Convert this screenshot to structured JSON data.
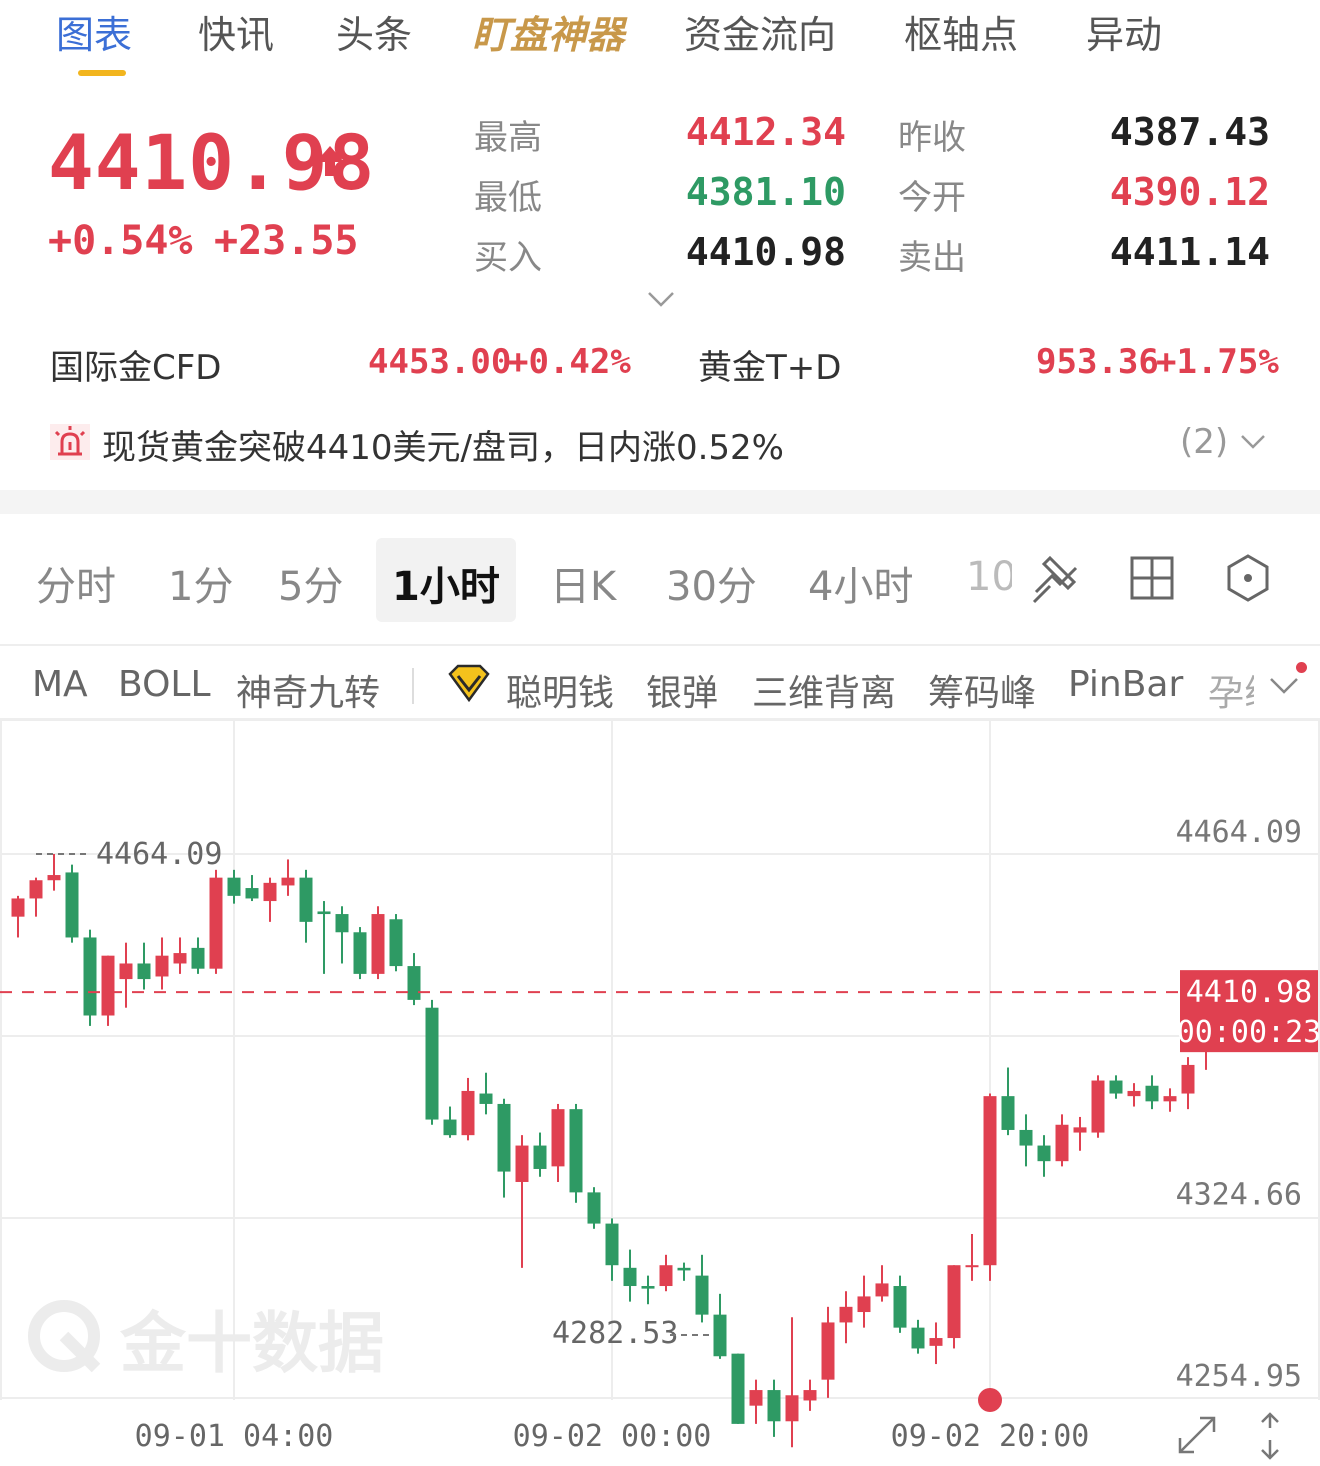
{
  "tabs": [
    {
      "label": "图表",
      "active": true
    },
    {
      "label": "快讯"
    },
    {
      "label": "头条"
    },
    {
      "label": "盯盘神器"
    },
    {
      "label": "资金流向"
    },
    {
      "label": "枢轴点"
    },
    {
      "label": "异动"
    }
  ],
  "quote": {
    "price": "4410.98",
    "change_pct": "+0.54%",
    "change_abs": "+23.55",
    "high_label": "最高",
    "high": "4412.34",
    "low_label": "最低",
    "low": "4381.10",
    "bid_label": "买入",
    "bid": "4410.98",
    "prev_close_label": "昨收",
    "prev_close": "4387.43",
    "open_label": "今开",
    "open": "4390.12",
    "ask_label": "卖出",
    "ask": "4411.14"
  },
  "related": [
    {
      "name": "国际金CFD",
      "price": "4453.00",
      "pct": "+0.42%"
    },
    {
      "name": "黄金T+D",
      "price": "953.36",
      "pct": "+1.75%"
    }
  ],
  "news": {
    "text": "现货黄金突破4410美元/盘司，日内涨0.52%",
    "count": "(2)"
  },
  "periods": [
    {
      "label": "分时"
    },
    {
      "label": "1分"
    },
    {
      "label": "5分"
    },
    {
      "label": "1小时",
      "active": true
    },
    {
      "label": "日K"
    },
    {
      "label": "30分"
    },
    {
      "label": "4小时"
    },
    {
      "label": "10"
    }
  ],
  "indicators": [
    "MA",
    "BOLL",
    "神奇九转",
    "聪明钱",
    "银弹",
    "三维背离",
    "筹码峰",
    "PinBar",
    "孕线"
  ],
  "colors": {
    "up": "#e04050",
    "down": "#2e9a64",
    "accent": "#3b6fd6",
    "tab_underline": "#f2b51e"
  },
  "chart_data": {
    "type": "candlestick",
    "ylim": [
      4254.95,
      4486.79
    ],
    "y_ticks": [
      4464.09,
      4324.66,
      4254.95
    ],
    "x_ticks": [
      {
        "index": 12,
        "label": "09-01 04:00"
      },
      {
        "index": 33,
        "label": "09-02 00:00"
      },
      {
        "index": 54,
        "label": "09-02 20:00"
      }
    ],
    "max_label": "4464.09",
    "min_label": "4282.53",
    "current_price": "4410.98",
    "countdown": "00:00:23",
    "watermark": "金十数据",
    "candles": [
      {
        "o": 4440,
        "h": 4448,
        "l": 4432,
        "c": 4447
      },
      {
        "o": 4447,
        "h": 4455,
        "l": 4440,
        "c": 4454
      },
      {
        "o": 4454,
        "h": 4464.09,
        "l": 4450,
        "c": 4456
      },
      {
        "o": 4457,
        "h": 4460,
        "l": 4430,
        "c": 4432
      },
      {
        "o": 4432,
        "h": 4435,
        "l": 4398,
        "c": 4402
      },
      {
        "o": 4402,
        "h": 4424,
        "l": 4398,
        "c": 4425
      },
      {
        "o": 4416,
        "h": 4430,
        "l": 4405,
        "c": 4422
      },
      {
        "o": 4422,
        "h": 4430,
        "l": 4412,
        "c": 4416
      },
      {
        "o": 4417,
        "h": 4432,
        "l": 4412,
        "c": 4425
      },
      {
        "o": 4422,
        "h": 4432,
        "l": 4418,
        "c": 4426
      },
      {
        "o": 4428,
        "h": 4432,
        "l": 4418,
        "c": 4420
      },
      {
        "o": 4420,
        "h": 4458,
        "l": 4418,
        "c": 4455
      },
      {
        "o": 4455,
        "h": 4458,
        "l": 4445,
        "c": 4448
      },
      {
        "o": 4451,
        "h": 4456,
        "l": 4446,
        "c": 4447
      },
      {
        "o": 4446,
        "h": 4455,
        "l": 4438,
        "c": 4453
      },
      {
        "o": 4452,
        "h": 4462,
        "l": 4448,
        "c": 4455
      },
      {
        "o": 4455,
        "h": 4458,
        "l": 4430,
        "c": 4438
      },
      {
        "o": 4442,
        "h": 4446,
        "l": 4418,
        "c": 4441
      },
      {
        "o": 4441,
        "h": 4444,
        "l": 4422,
        "c": 4434
      },
      {
        "o": 4434,
        "h": 4436,
        "l": 4416,
        "c": 4418
      },
      {
        "o": 4418,
        "h": 4444,
        "l": 4416,
        "c": 4441
      },
      {
        "o": 4439,
        "h": 4441,
        "l": 4419,
        "c": 4421
      },
      {
        "o": 4421,
        "h": 4426,
        "l": 4406,
        "c": 4408
      },
      {
        "o": 4405,
        "h": 4408,
        "l": 4360,
        "c": 4362
      },
      {
        "o": 4362,
        "h": 4367,
        "l": 4355,
        "c": 4356
      },
      {
        "o": 4356,
        "h": 4378,
        "l": 4354,
        "c": 4373
      },
      {
        "o": 4372,
        "h": 4380,
        "l": 4364,
        "c": 4368
      },
      {
        "o": 4368,
        "h": 4370,
        "l": 4332,
        "c": 4342
      },
      {
        "o": 4338,
        "h": 4356,
        "l": 4305,
        "c": 4352
      },
      {
        "o": 4352,
        "h": 4357,
        "l": 4340,
        "c": 4343
      },
      {
        "o": 4344,
        "h": 4368,
        "l": 4338,
        "c": 4366
      },
      {
        "o": 4366,
        "h": 4368,
        "l": 4330,
        "c": 4334
      },
      {
        "o": 4334,
        "h": 4336,
        "l": 4320,
        "c": 4322
      },
      {
        "o": 4322,
        "h": 4324,
        "l": 4300,
        "c": 4306
      },
      {
        "o": 4305,
        "h": 4312,
        "l": 4292,
        "c": 4298
      },
      {
        "o": 4298,
        "h": 4302,
        "l": 4291,
        "c": 4297
      },
      {
        "o": 4298,
        "h": 4310,
        "l": 4296,
        "c": 4306
      },
      {
        "o": 4305,
        "h": 4307,
        "l": 4300,
        "c": 4304
      },
      {
        "o": 4302,
        "h": 4310,
        "l": 4284,
        "c": 4287
      },
      {
        "o": 4287,
        "h": 4295,
        "l": 4270,
        "c": 4271
      },
      {
        "o": 4272,
        "h": 4270,
        "l": 4282.53,
        "c": 4245
      },
      {
        "o": 4252,
        "h": 4262,
        "l": 4245,
        "c": 4258
      },
      {
        "o": 4258,
        "h": 4262,
        "l": 4240,
        "c": 4246
      },
      {
        "o": 4246,
        "h": 4286,
        "l": 4236,
        "c": 4256
      },
      {
        "o": 4254,
        "h": 4262,
        "l": 4250,
        "c": 4258
      },
      {
        "o": 4262,
        "h": 4290,
        "l": 4255,
        "c": 4284
      },
      {
        "o": 4284,
        "h": 4296,
        "l": 4276,
        "c": 4290
      },
      {
        "o": 4288,
        "h": 4302,
        "l": 4282,
        "c": 4294
      },
      {
        "o": 4294,
        "h": 4306,
        "l": 4292,
        "c": 4299
      },
      {
        "o": 4298,
        "h": 4302,
        "l": 4280,
        "c": 4282
      },
      {
        "o": 4282,
        "h": 4285,
        "l": 4272,
        "c": 4274
      },
      {
        "o": 4275,
        "h": 4284,
        "l": 4268,
        "c": 4278
      },
      {
        "o": 4278,
        "h": 4306,
        "l": 4274,
        "c": 4306
      },
      {
        "o": 4306,
        "h": 4318,
        "l": 4300,
        "c": 4306
      },
      {
        "o": 4306,
        "h": 4372,
        "l": 4300,
        "c": 4371
      },
      {
        "o": 4371,
        "h": 4382,
        "l": 4356,
        "c": 4358
      },
      {
        "o": 4358,
        "h": 4364,
        "l": 4344,
        "c": 4352
      },
      {
        "o": 4352,
        "h": 4356,
        "l": 4340,
        "c": 4346
      },
      {
        "o": 4346,
        "h": 4364,
        "l": 4344,
        "c": 4360
      },
      {
        "o": 4357,
        "h": 4363,
        "l": 4350,
        "c": 4359
      },
      {
        "o": 4357,
        "h": 4379,
        "l": 4355,
        "c": 4377
      },
      {
        "o": 4377,
        "h": 4379,
        "l": 4370,
        "c": 4372
      },
      {
        "o": 4371,
        "h": 4376,
        "l": 4367,
        "c": 4373
      },
      {
        "o": 4375,
        "h": 4379,
        "l": 4366,
        "c": 4369
      },
      {
        "o": 4369,
        "h": 4374,
        "l": 4365,
        "c": 4371
      },
      {
        "o": 4372,
        "h": 4386,
        "l": 4366,
        "c": 4383
      },
      {
        "o": 4390.12,
        "h": 4412.34,
        "l": 4381.1,
        "c": 4410.98
      }
    ]
  }
}
